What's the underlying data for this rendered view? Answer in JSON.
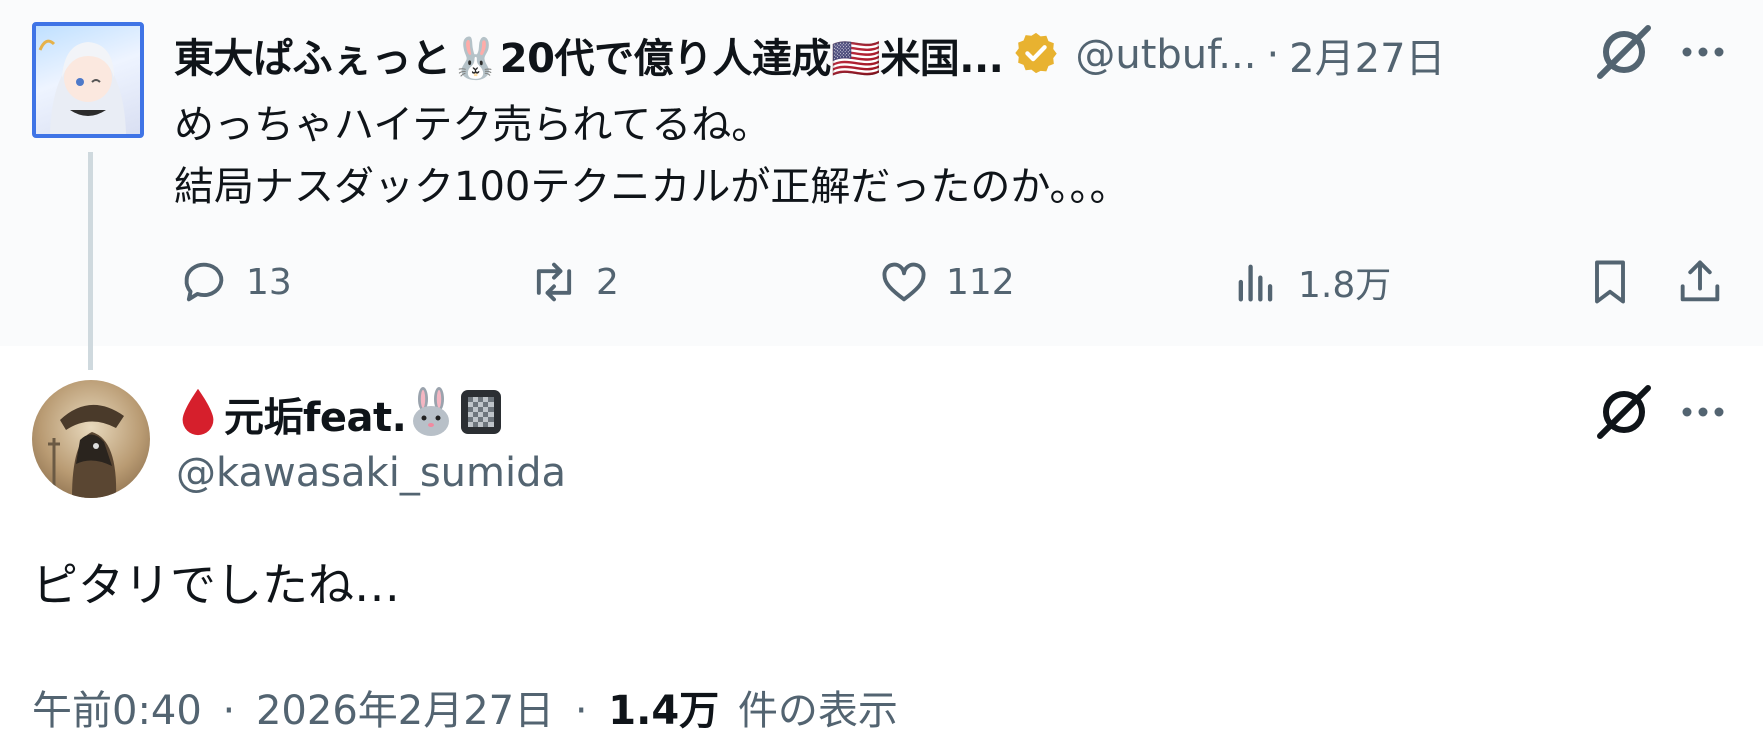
{
  "parent_tweet": {
    "display_name": "東大ぱふぇっと🐰20代で億り人達成🇺🇸米国...",
    "handle": "@utbuf...",
    "separator": "·",
    "date": "2月27日",
    "text_line1": "めっちゃハイテク売られてるね。",
    "text_line2": "結局ナスダック100テクニカルが正解だったのか。。。",
    "replies": "13",
    "reposts": "2",
    "likes": "112",
    "views": "1.8万"
  },
  "reply_tweet": {
    "display_name_suffix": "元垢feat.",
    "handle": "@kawasaki_sumida",
    "text": "ピタリでしたね…",
    "time": "午前0:40",
    "sep1": "·",
    "date": "2026年2月27日",
    "sep2": "·",
    "views_count": "1.4万",
    "views_label": "件の表示"
  },
  "colors": {
    "verified": "#e8b230",
    "thread_line": "#cfd9de",
    "muted": "#536471",
    "avatar_border": "#3f74e6"
  },
  "icons": [
    "grok-icon",
    "more-icon",
    "reply-icon",
    "repost-icon",
    "like-icon",
    "views-icon",
    "bookmark-icon",
    "share-icon"
  ]
}
